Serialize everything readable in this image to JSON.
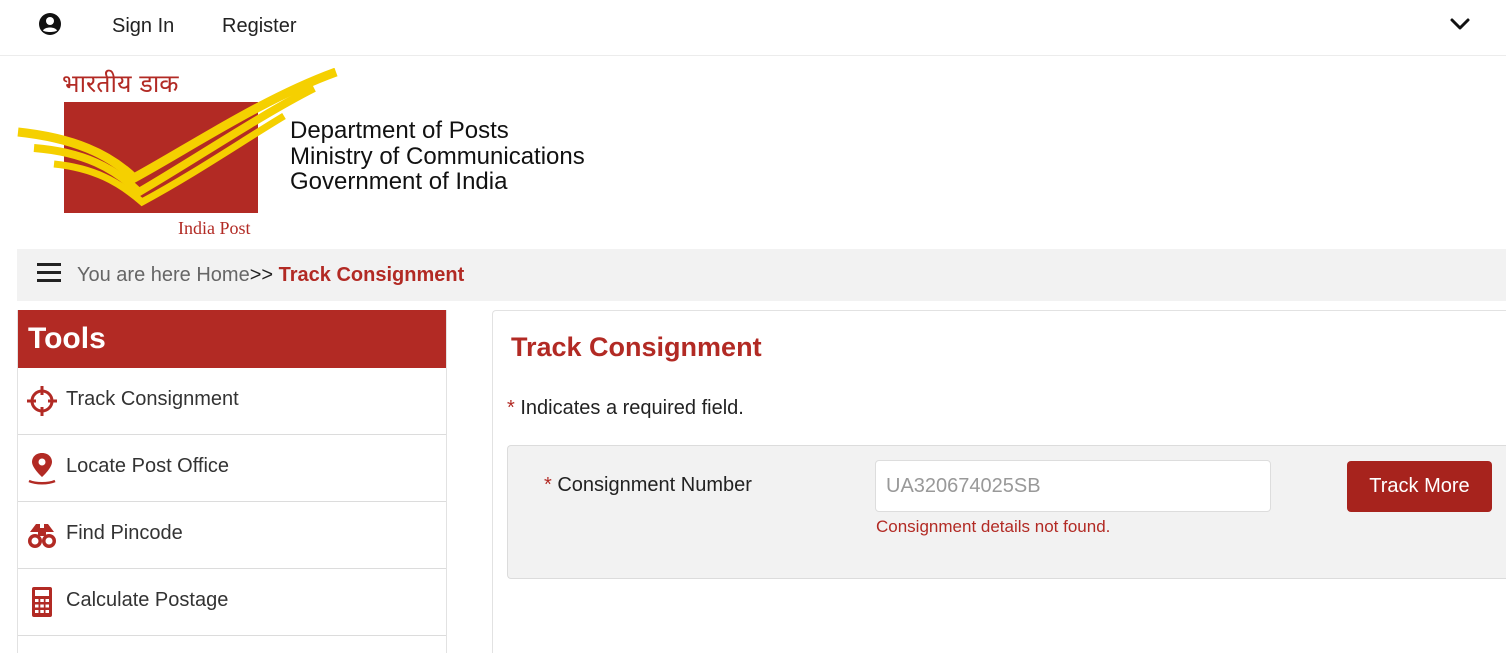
{
  "topbar": {
    "signin_label": "Sign In",
    "register_label": "Register"
  },
  "header": {
    "hindi_title": "भारतीय डाक",
    "logo_caption": "India Post",
    "org_lines": [
      "Department of Posts",
      "Ministry of Communications",
      "Government of India"
    ]
  },
  "breadcrumb": {
    "prefix": "You are here Home",
    "separator": ">>",
    "current": "Track Consignment"
  },
  "sidebar": {
    "title": "Tools",
    "items": [
      {
        "label": "Track Consignment",
        "icon": "crosshair-icon"
      },
      {
        "label": "Locate Post Office",
        "icon": "map-pin-icon"
      },
      {
        "label": "Find Pincode",
        "icon": "binoculars-icon"
      },
      {
        "label": "Calculate Postage",
        "icon": "calculator-icon"
      }
    ]
  },
  "main": {
    "title": "Track Consignment",
    "required_star": "*",
    "required_note": "Indicates a required field.",
    "field_label": "Consignment Number",
    "input_value": "UA320674025SB",
    "error_text": "Consignment details not found.",
    "button_label": "Track More"
  },
  "colors": {
    "brand_red": "#b22a24",
    "logo_yellow": "#f5d000",
    "panel_gray": "#f2f2f2"
  }
}
